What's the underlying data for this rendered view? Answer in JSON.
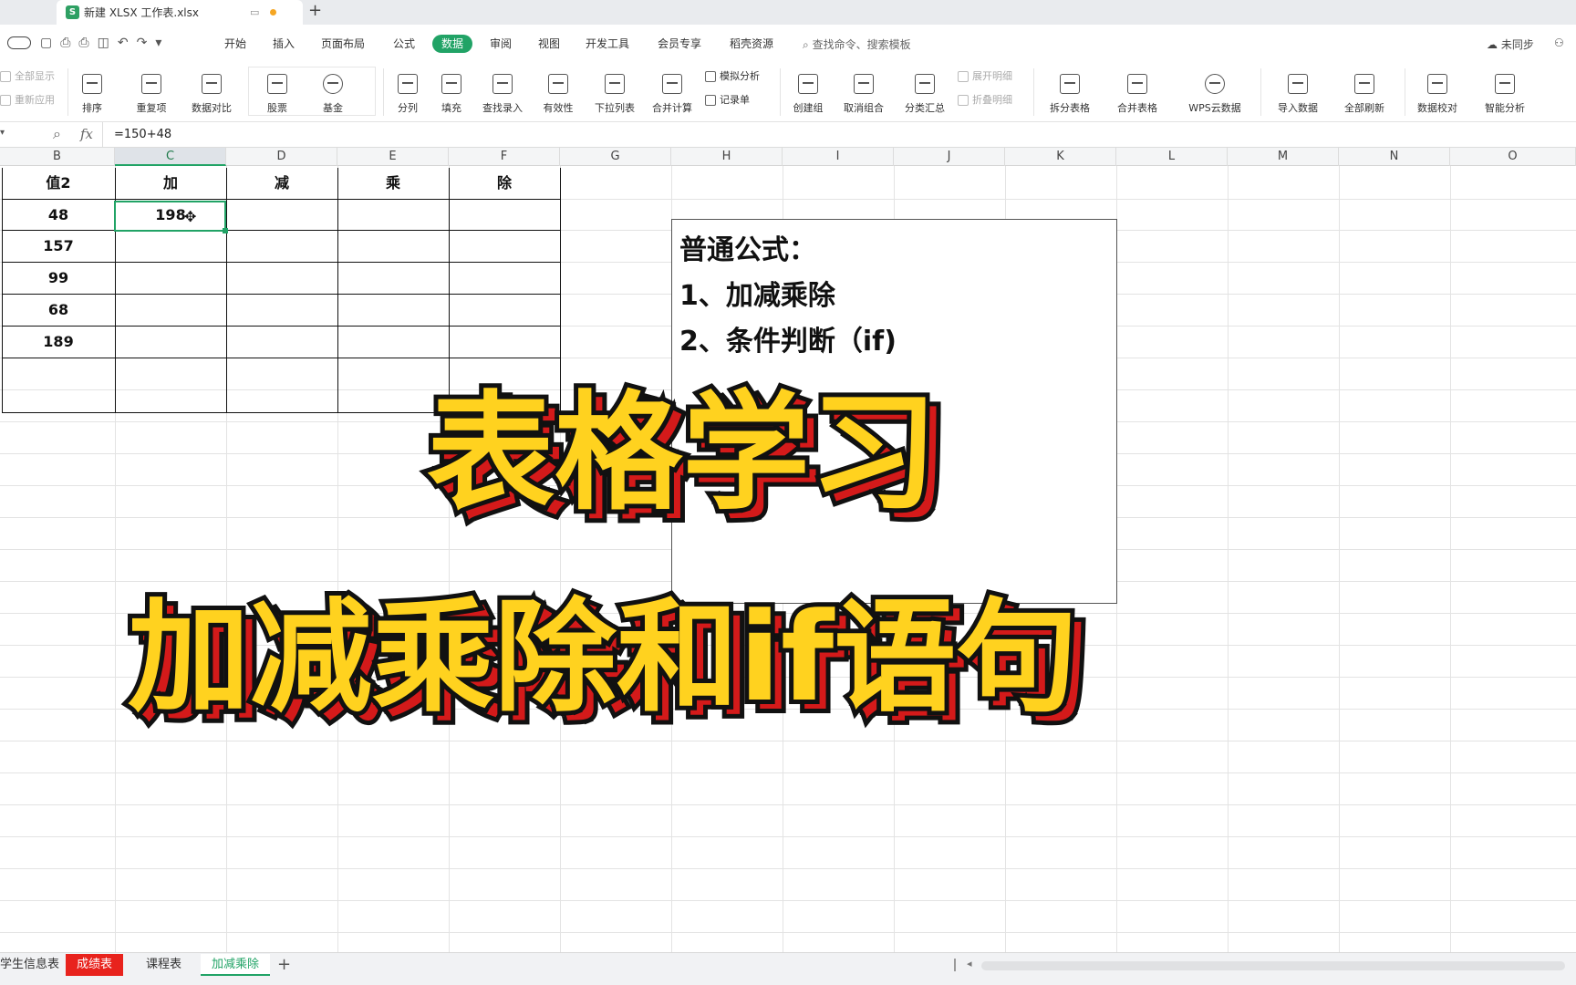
{
  "window": {
    "doc_tab_title": "新建 XLSX 工作表.xlsx",
    "app_badge": "S"
  },
  "menu": {
    "tabs": [
      "开始",
      "插入",
      "页面布局",
      "公式",
      "数据",
      "审阅",
      "视图",
      "开发工具",
      "会员专享",
      "稻壳资源"
    ],
    "active": "数据",
    "search_placeholder": "查找命令、搜索模板",
    "sync_label": "未同步"
  },
  "ribbon": {
    "show_all": "全部显示",
    "reapply": "重新应用",
    "sort": "排序",
    "duplicates": "重复项",
    "compare": "数据对比",
    "stock": "股票",
    "fund": "基金",
    "split_col": "分列",
    "fill": "填充",
    "lookup": "查找录入",
    "validity": "有效性",
    "dropdown": "下拉列表",
    "consolidate": "合并计算",
    "simulate": "模拟分析",
    "record": "记录单",
    "group": "创建组",
    "ungroup": "取消组合",
    "subtotal": "分类汇总",
    "expand": "展开明细",
    "collapse": "折叠明细",
    "split_table": "拆分表格",
    "merge_table": "合并表格",
    "wps_cloud": "WPS云数据",
    "import": "导入数据",
    "refresh_all": "全部刷新",
    "verify": "数据校对",
    "smart": "智能分析"
  },
  "formula_bar": {
    "fx": "fx",
    "formula": "=150+48"
  },
  "grid": {
    "columns": [
      "B",
      "C",
      "D",
      "E",
      "F",
      "G",
      "H",
      "I",
      "J",
      "K",
      "L",
      "M",
      "N",
      "O"
    ],
    "selected_column": "C",
    "header_row": [
      "值2",
      "加",
      "减",
      "乘",
      "除"
    ],
    "values_b": [
      "48",
      "157",
      "99",
      "68",
      "189"
    ],
    "c1_value": "198"
  },
  "note": {
    "line1": "普通公式：",
    "line2": "1、加减乘除",
    "line3": "2、条件判断（if)"
  },
  "overlay": {
    "title1": "表格学习",
    "title2": "加减乘除和if语句"
  },
  "sheets": {
    "tabs": [
      "学生信息表",
      "成绩表",
      "课程表",
      "加减乘除"
    ],
    "add": "+"
  },
  "colors": {
    "accent": "#21a366",
    "headline_fill": "#ffd21f",
    "headline_shadow": "#d41a1a",
    "tab_red": "#e8231d"
  }
}
